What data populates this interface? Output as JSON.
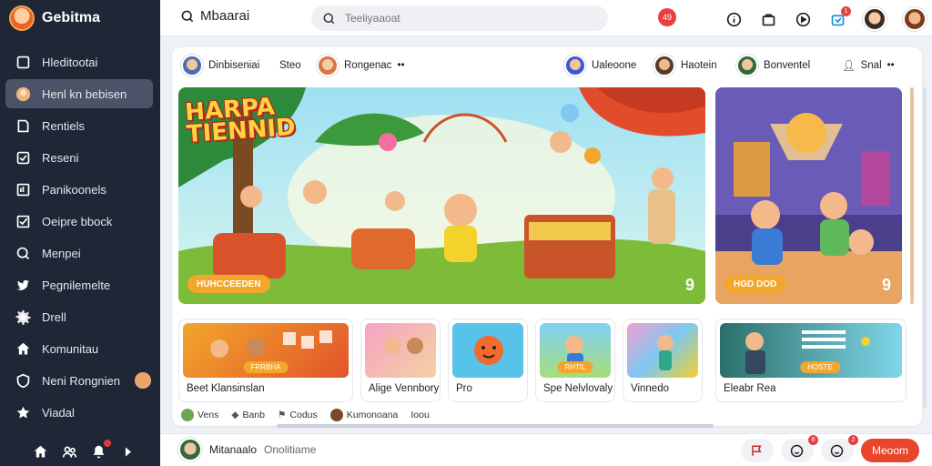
{
  "app": {
    "name": "Gebitma"
  },
  "sidebar": {
    "items": [
      {
        "label": "Hleditootai",
        "icon": "square-icon"
      },
      {
        "label": "Henl kn bebisen",
        "icon": "avatar-icon",
        "active": true
      },
      {
        "label": "Rentiels",
        "icon": "bookmark-icon"
      },
      {
        "label": "Reseni",
        "icon": "check-square-icon"
      },
      {
        "label": "Panikoonels",
        "icon": "image-icon"
      },
      {
        "label": "Oeipre bbock",
        "icon": "checkbox-icon"
      },
      {
        "label": "Menpei",
        "icon": "search-icon"
      },
      {
        "label": "Pegnilemelte",
        "icon": "bird-icon"
      },
      {
        "label": "Drell",
        "icon": "gear-icon"
      },
      {
        "label": "Komunitau",
        "icon": "home-icon"
      },
      {
        "label": "Neni Rongnien",
        "icon": "shield-icon",
        "badge": true
      },
      {
        "label": "Viadal",
        "icon": "star-icon"
      }
    ],
    "bottom_icons": [
      "home-icon",
      "users-icon",
      "bell-icon",
      "share-icon"
    ]
  },
  "topbar": {
    "title": "Mbaarai",
    "search_placeholder": "Teeliyaaoat",
    "alert_count": "49",
    "notif_count": "1"
  },
  "user_row": {
    "left_user": "Dinbiseniai",
    "left_meta": "Steo",
    "left_user2": "Rongenac",
    "right": [
      {
        "label": "Ualeoone"
      },
      {
        "label": "Haotein"
      },
      {
        "label": "Bonventel"
      },
      {
        "label": "Snal"
      }
    ]
  },
  "hero": {
    "title_line1": "HARPA",
    "title_line2": "TIENNID",
    "tag": "HUHCCEEDEN",
    "number": "9"
  },
  "hero2": {
    "tag": "HGD DOD",
    "number": "9"
  },
  "thumbs": [
    {
      "label": "Beet Klansinslan",
      "pill": "FRRBHA"
    },
    {
      "label": "Alige Vennbory"
    },
    {
      "label": "Pro"
    },
    {
      "label": "Spe Nelvlovaly",
      "pill": "RHTIL"
    },
    {
      "label": "Vinnedo"
    },
    {
      "label": "Eleabr Rea",
      "pill": "HOSTE"
    }
  ],
  "authors": [
    {
      "label": "Vens"
    },
    {
      "label": "Banb"
    },
    {
      "label": "Codus"
    },
    {
      "label": "Kumonoana"
    },
    {
      "label": "Ioou"
    }
  ],
  "bottombar": {
    "user_name": "Mitanaalo",
    "user_status": "Onolitiame",
    "primary_label": "Meoom",
    "badge1": "8",
    "badge2": "2"
  },
  "colors": {
    "sidebar": "#1f2636",
    "accent": "#e8452c",
    "tag": "#f2a62b"
  }
}
